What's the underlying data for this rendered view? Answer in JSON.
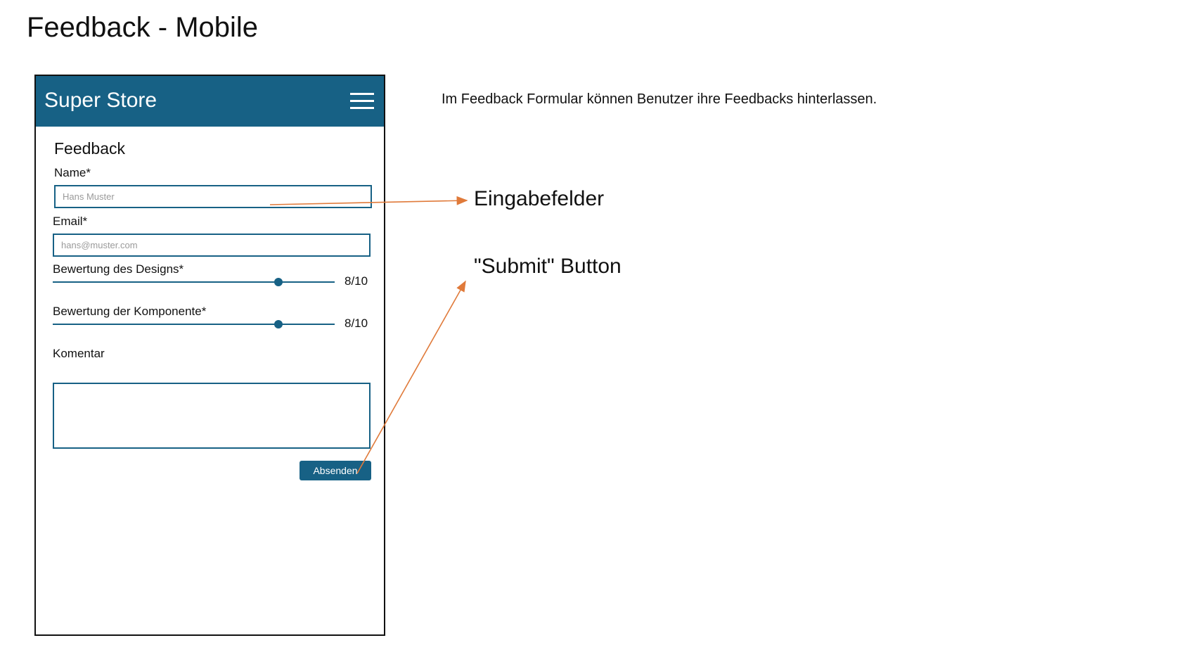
{
  "slide": {
    "title": "Feedback - Mobile",
    "description": "Im Feedback Formular können Benutzer ihre Feedbacks hinterlassen."
  },
  "callouts": {
    "inputs_label": "Eingabefelder",
    "submit_label": "\"Submit\" Button",
    "arrow_color": "#E07A3A"
  },
  "app": {
    "title": "Super Store",
    "header_color": "#176185",
    "menu_icon": "hamburger-menu-icon"
  },
  "form": {
    "title": "Feedback",
    "name": {
      "label": "Name*",
      "placeholder": "Hans Muster"
    },
    "email": {
      "label": "Email*",
      "placeholder": "hans@muster.com"
    },
    "design_rating": {
      "label": "Bewertung des Designs*",
      "value": 8,
      "max": 10,
      "display": "8/10"
    },
    "component_rating": {
      "label": "Bewertung der Komponente*",
      "value": 8,
      "max": 10,
      "display": "8/10"
    },
    "comment": {
      "label": "Komentar",
      "value": ""
    },
    "submit_label": "Absenden"
  }
}
